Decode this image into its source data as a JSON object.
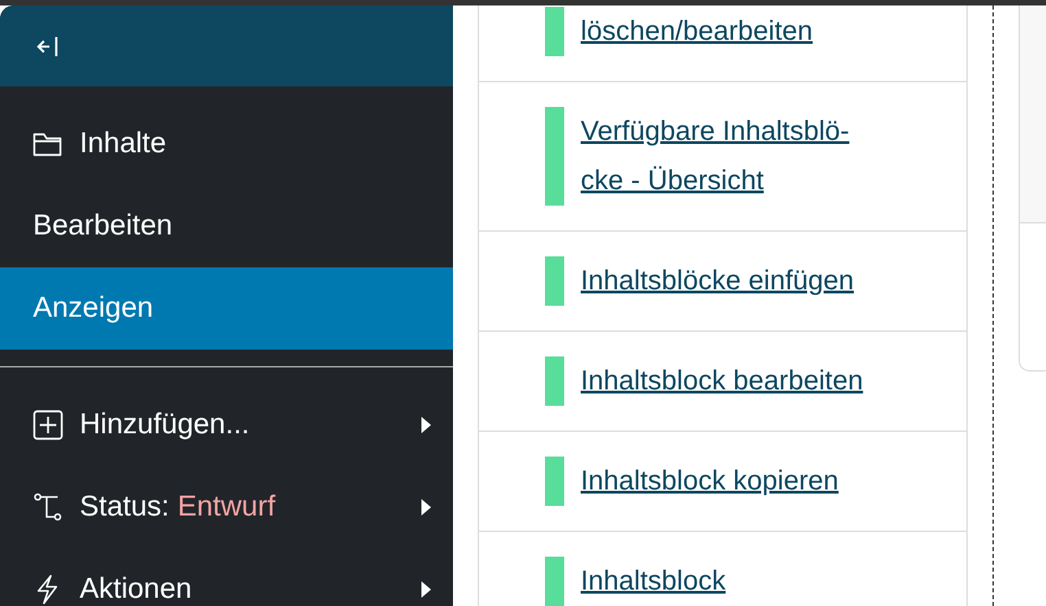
{
  "sidebar": {
    "nav_items": [
      {
        "label": "Inhalte",
        "selected": false
      },
      {
        "label": "Bearbeiten",
        "selected": false
      },
      {
        "label": "Anzeigen",
        "selected": true
      }
    ],
    "action_items": [
      {
        "label": "Hinzufügen...",
        "submenu": true
      },
      {
        "label": "Status:",
        "value": "Entwurf",
        "submenu": true
      },
      {
        "label": "Aktionen",
        "submenu": true
      }
    ]
  },
  "links": [
    "löschen/bearbeiten",
    "Verfügbare Inhaltsblö-cke - Übersicht",
    "Inhaltsblöcke einfügen",
    "Inhaltsblock bearbeiten",
    "Inhaltsblock kopieren",
    "Inhaltsblock"
  ]
}
